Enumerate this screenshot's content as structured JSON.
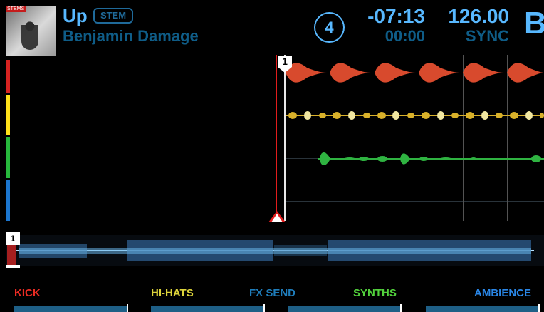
{
  "track": {
    "art_label": "STEMS",
    "title": "Up",
    "format_badge": "STEM",
    "artist": "Benjamin Damage"
  },
  "deck": {
    "number": "4",
    "time_remaining": "-07:13",
    "time_elapsed": "00:00",
    "bpm": "126.00",
    "sync": "SYNC",
    "deck_letter": "B"
  },
  "cue": {
    "main_marker": "1",
    "overview_marker": "1"
  },
  "stems": [
    {
      "name": "KICK",
      "color": "#ea2b23"
    },
    {
      "name": "HI-HATS",
      "color": "#ddd43b"
    },
    {
      "name": "FX SEND",
      "color": "#1f7dbb"
    },
    {
      "name": "SYNTHS",
      "color": "#52d13c"
    },
    {
      "name": "AMBIENCE",
      "color": "#2a87e8"
    }
  ],
  "colors": {
    "accent": "#58b8ff",
    "accent_dark": "#0f5d88",
    "playhead": "#e11d1d",
    "waveform_red": "#d84a2d",
    "waveform_yellow": "#d9b12a",
    "waveform_green": "#2fb341",
    "waveform_blue": "#3a7bb7"
  }
}
